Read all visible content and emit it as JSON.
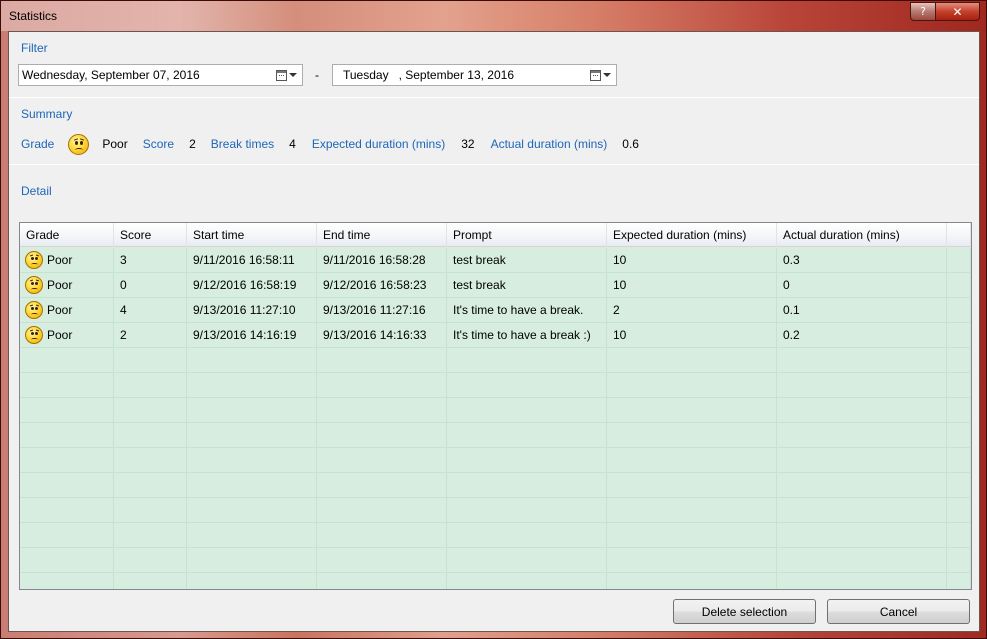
{
  "window": {
    "title": "Statistics",
    "help_label": "?",
    "close_label": "✕"
  },
  "filter": {
    "label": "Filter",
    "start_date": "Wednesday, September 07, 2016",
    "separator": "-",
    "end_date": "Tuesday   , September 13, 2016"
  },
  "summary": {
    "label": "Summary",
    "grade_label": "Grade",
    "grade_value": "Poor",
    "score_label": "Score",
    "score_value": "2",
    "break_times_label": "Break times",
    "break_times_value": "4",
    "expected_label": "Expected duration (mins)",
    "expected_value": "32",
    "actual_label": "Actual duration (mins)",
    "actual_value": "0.6"
  },
  "detail": {
    "label": "Detail",
    "columns": [
      "Grade",
      "Score",
      "Start time",
      "End time",
      "Prompt",
      "Expected duration (mins)",
      "Actual duration (mins)"
    ],
    "rows": [
      {
        "grade": "Poor",
        "score": "3",
        "start": "9/11/2016 16:58:11",
        "end": "9/11/2016 16:58:28",
        "prompt": "test break",
        "expected": "10",
        "actual": "0.3"
      },
      {
        "grade": "Poor",
        "score": "0",
        "start": "9/12/2016 16:58:19",
        "end": "9/12/2016 16:58:23",
        "prompt": "test break",
        "expected": "10",
        "actual": "0"
      },
      {
        "grade": "Poor",
        "score": "4",
        "start": "9/13/2016 11:27:10",
        "end": "9/13/2016 11:27:16",
        "prompt": "It's time to have a break.",
        "expected": "2",
        "actual": "0.1"
      },
      {
        "grade": "Poor",
        "score": "2",
        "start": "9/13/2016 14:16:19",
        "end": "9/13/2016 14:16:33",
        "prompt": "It's time to have a break :)",
        "expected": "10",
        "actual": "0.2"
      }
    ]
  },
  "buttons": {
    "delete_label": "Delete selection",
    "cancel_label": "Cancel"
  },
  "colors": {
    "accent": "#1e66b8",
    "grid_background": "#d6eddf",
    "titlebar_tint": "#b5463a"
  },
  "icons": {
    "grade": "sad-face-icon",
    "calendar": "calendar-icon",
    "dropdown": "chevron-down-icon"
  }
}
